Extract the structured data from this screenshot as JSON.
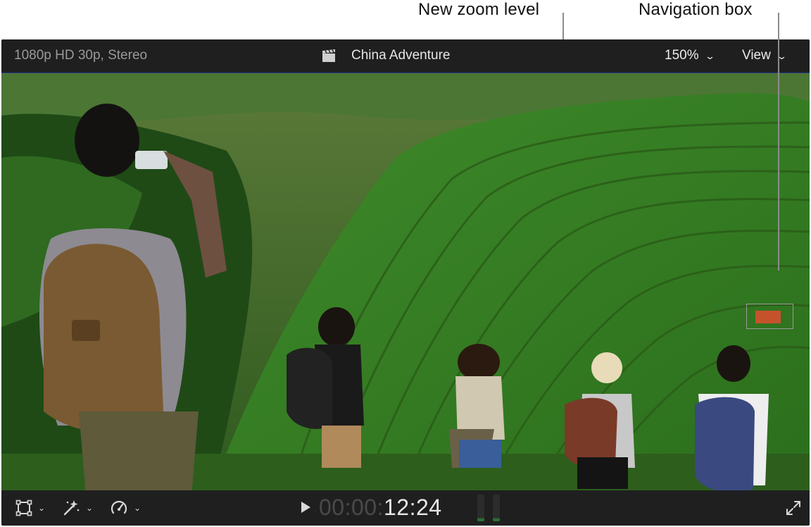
{
  "callouts": {
    "zoom_label": "New zoom level",
    "navigation_label": "Navigation box"
  },
  "viewer": {
    "format_info": "1080p HD 30p, Stereo",
    "clip_icon": "clapperboard-icon",
    "clip_title": "China Adventure",
    "zoom_level": "150%",
    "view_menu": "View"
  },
  "playback": {
    "timecode_dim": "00:00:",
    "timecode_lit": "12:24"
  },
  "tools": {
    "transform_icon": "transform-icon",
    "enhance_icon": "magic-wand-icon",
    "retime_icon": "speedometer-icon",
    "fullscreen_icon": "fullscreen-icon"
  },
  "colors": {
    "navigation_highlight": "#c6522c",
    "accent_line": "#2b3f8f",
    "audio_meter": "#2c6d35"
  }
}
